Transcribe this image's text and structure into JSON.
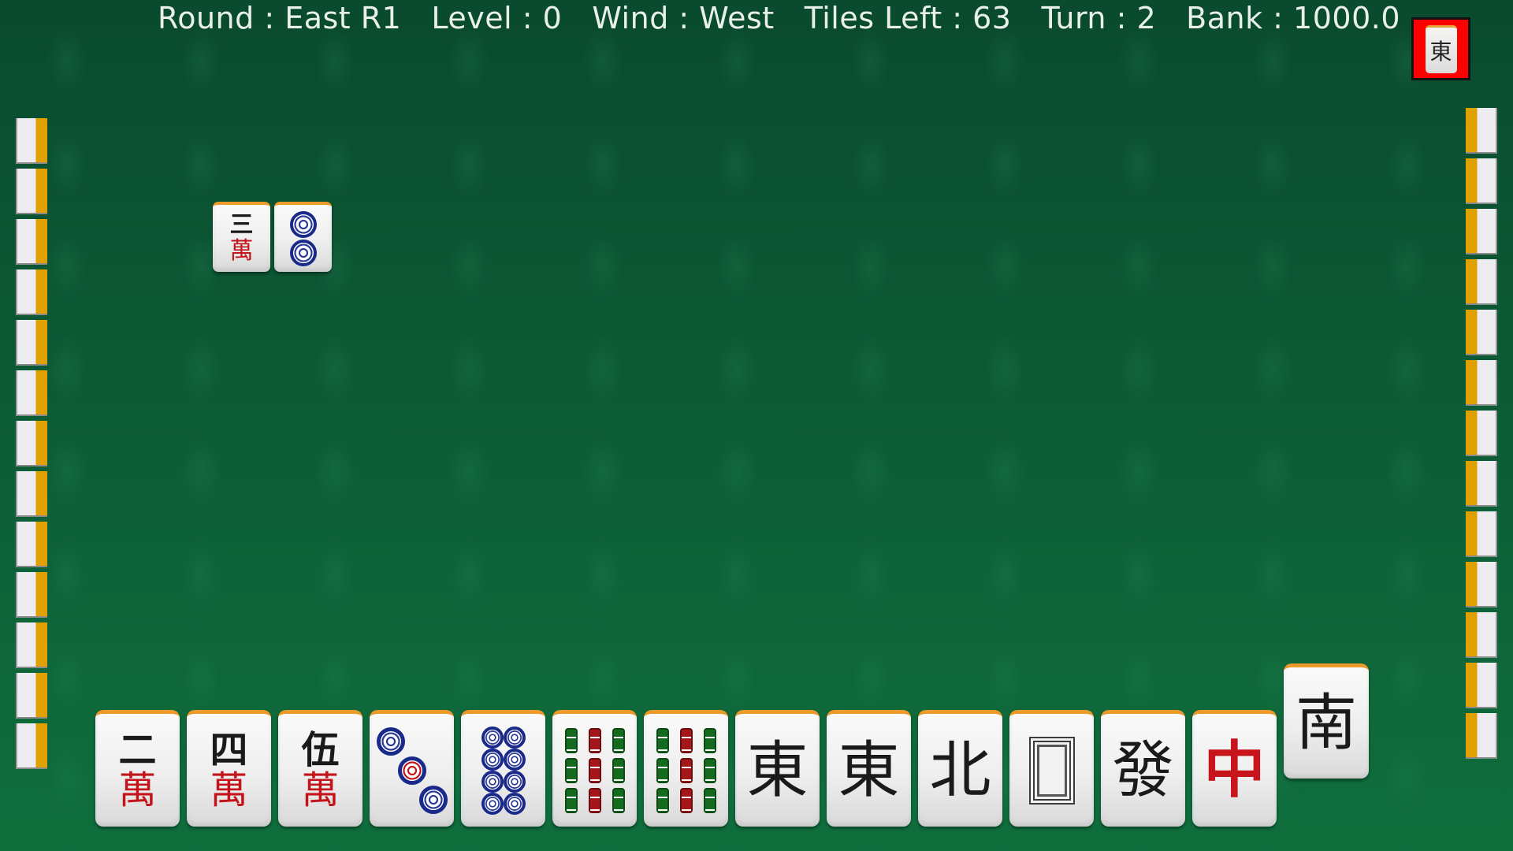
{
  "hud": {
    "round_label": "Round : East R1",
    "level_label": "Level : 0",
    "wind_label": "Wind : West",
    "tiles_left_label": "Tiles Left : 63",
    "turn_label": "Turn : 2",
    "bank_label": "Bank : 1000.0"
  },
  "round_indicator": {
    "glyph": "東",
    "meaning": "east",
    "highlight_color": "#ff0000"
  },
  "walls": {
    "left_count": 13,
    "right_count": 13
  },
  "discards": [
    {
      "suit": "man",
      "rank": 3,
      "top": "三",
      "bottom": "萬"
    },
    {
      "suit": "pin",
      "rank": 2
    }
  ],
  "hand": [
    {
      "suit": "man",
      "rank": 2,
      "top": "二",
      "bottom": "萬"
    },
    {
      "suit": "man",
      "rank": 4,
      "top": "四",
      "bottom": "萬"
    },
    {
      "suit": "man",
      "rank": 5,
      "top": "伍",
      "bottom": "萬"
    },
    {
      "suit": "pin",
      "rank": 3
    },
    {
      "suit": "pin",
      "rank": 8
    },
    {
      "suit": "sou",
      "rank": 9
    },
    {
      "suit": "sou",
      "rank": 9
    },
    {
      "suit": "honor",
      "glyph": "東",
      "name": "east-wind"
    },
    {
      "suit": "honor",
      "glyph": "東",
      "name": "east-wind"
    },
    {
      "suit": "honor",
      "glyph": "北",
      "name": "north-wind"
    },
    {
      "suit": "honor",
      "glyph": "",
      "name": "white-dragon"
    },
    {
      "suit": "honor",
      "glyph": "發",
      "name": "green-dragon"
    },
    {
      "suit": "honor",
      "glyph": "中",
      "name": "red-dragon"
    }
  ],
  "drawn_tile": {
    "suit": "honor",
    "glyph": "南",
    "name": "south-wind"
  },
  "colors": {
    "table_green": "#0b5a34",
    "tile_edge": "#ec9a2a",
    "man_red": "#c4141b",
    "pin_blue": "#1a2a8a",
    "sou_green": "#146b1e"
  }
}
